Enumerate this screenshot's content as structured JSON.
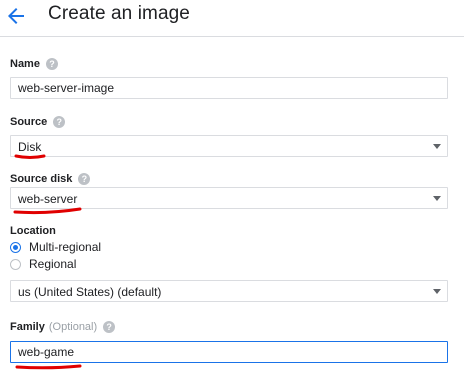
{
  "header": {
    "title": "Create an image",
    "back_icon": "arrow-back-icon"
  },
  "form": {
    "name": {
      "label": "Name",
      "value": "web-server-image"
    },
    "source": {
      "label": "Source",
      "value": "Disk"
    },
    "source_disk": {
      "label": "Source disk",
      "value": "web-server"
    },
    "location": {
      "label": "Location",
      "options": [
        "Multi-regional",
        "Regional"
      ],
      "selected": "Multi-regional",
      "region_value": "us (United States) (default)"
    },
    "family": {
      "label": "Family",
      "optional": "(Optional)",
      "value": "web-game"
    }
  },
  "colors": {
    "accent": "#1a73e8",
    "annotation": "#e00000"
  }
}
